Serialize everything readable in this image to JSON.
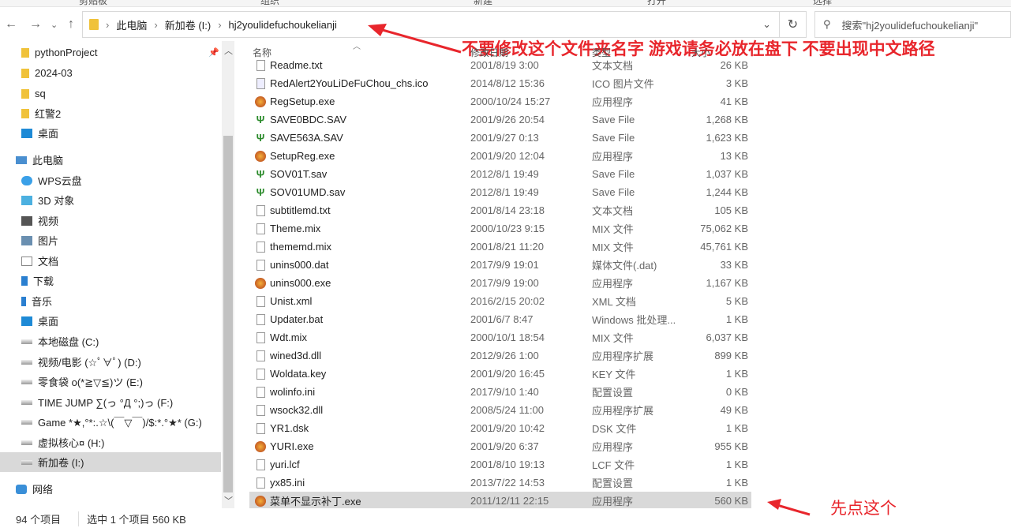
{
  "ribbon": [
    "剪贴板",
    "组织",
    "新建",
    "打开",
    "选择"
  ],
  "breadcrumb": [
    "此电脑",
    "新加卷 (I:)",
    "hj2youlidefuchoukelianji"
  ],
  "search_placeholder": "搜索\"hj2youlidefuchoukelianji\"",
  "annotations": {
    "top": "不要修改这个文件夹名字 游戏请务必放在盘下 不要出现中文路径",
    "bottom": "先点这个"
  },
  "columns": [
    "名称",
    "修改日期",
    "类型",
    "大小"
  ],
  "sidebar": [
    {
      "label": "pythonProject",
      "icon": "folder-icon",
      "pinned": true
    },
    {
      "label": "2024-03",
      "icon": "folder-icon"
    },
    {
      "label": "sq",
      "icon": "folder-icon"
    },
    {
      "label": "红警2",
      "icon": "folder-icon"
    },
    {
      "label": "桌面",
      "icon": "desktop-icon"
    },
    {
      "label": "此电脑",
      "icon": "computer-icon"
    },
    {
      "label": "WPS云盘",
      "icon": "cloud-icon"
    },
    {
      "label": "3D 对象",
      "icon": "cube-icon"
    },
    {
      "label": "视频",
      "icon": "video-icon"
    },
    {
      "label": "图片",
      "icon": "picture-icon"
    },
    {
      "label": "文档",
      "icon": "document-icon"
    },
    {
      "label": "下载",
      "icon": "download-icon"
    },
    {
      "label": "音乐",
      "icon": "music-icon"
    },
    {
      "label": "桌面",
      "icon": "desktop-icon"
    },
    {
      "label": "本地磁盘 (C:)",
      "icon": "drive-icon"
    },
    {
      "label": "视频/电影 (☆ﾟ∀ﾟ) (D:)",
      "icon": "drive-icon"
    },
    {
      "label": "零食袋 o(*≧▽≦)ツ (E:)",
      "icon": "drive-icon"
    },
    {
      "label": "TIME JUMP ∑(っ °Д °;)っ (F:)",
      "icon": "drive-icon"
    },
    {
      "label": "Game  *★,°*:.☆\\(￣▽￣)/$:*.°★* (G:)",
      "icon": "drive-icon"
    },
    {
      "label": "虚拟核心¤ (H:)",
      "icon": "drive-icon"
    },
    {
      "label": "新加卷 (I:)",
      "icon": "drive-icon",
      "selected": true
    },
    {
      "label": "网络",
      "icon": "network-icon"
    }
  ],
  "files": [
    {
      "name": "Readme.txt",
      "date": "2001/8/19 3:00",
      "type": "文本文档",
      "size": "26 KB"
    },
    {
      "name": "RedAlert2YouLiDeFuChou_chs.ico",
      "date": "2014/8/12 15:36",
      "type": "ICO 图片文件",
      "size": "3 KB"
    },
    {
      "name": "RegSetup.exe",
      "date": "2000/10/24 15:27",
      "type": "应用程序",
      "size": "41 KB"
    },
    {
      "name": "SAVE0BDC.SAV",
      "date": "2001/9/26 20:54",
      "type": "Save File",
      "size": "1,268 KB"
    },
    {
      "name": "SAVE563A.SAV",
      "date": "2001/9/27 0:13",
      "type": "Save File",
      "size": "1,623 KB"
    },
    {
      "name": "SetupReg.exe",
      "date": "2001/9/20 12:04",
      "type": "应用程序",
      "size": "13 KB"
    },
    {
      "name": "SOV01T.sav",
      "date": "2012/8/1 19:49",
      "type": "Save File",
      "size": "1,037 KB"
    },
    {
      "name": "SOV01UMD.sav",
      "date": "2012/8/1 19:49",
      "type": "Save File",
      "size": "1,244 KB"
    },
    {
      "name": "subtitlemd.txt",
      "date": "2001/8/14 23:18",
      "type": "文本文档",
      "size": "105 KB"
    },
    {
      "name": "Theme.mix",
      "date": "2000/10/23 9:15",
      "type": "MIX 文件",
      "size": "75,062 KB"
    },
    {
      "name": "thememd.mix",
      "date": "2001/8/21 11:20",
      "type": "MIX 文件",
      "size": "45,761 KB"
    },
    {
      "name": "unins000.dat",
      "date": "2017/9/9 19:01",
      "type": "媒体文件(.dat)",
      "size": "33 KB"
    },
    {
      "name": "unins000.exe",
      "date": "2017/9/9 19:00",
      "type": "应用程序",
      "size": "1,167 KB"
    },
    {
      "name": "Unist.xml",
      "date": "2016/2/15 20:02",
      "type": "XML 文档",
      "size": "5 KB"
    },
    {
      "name": "Updater.bat",
      "date": "2001/6/7 8:47",
      "type": "Windows 批处理...",
      "size": "1 KB"
    },
    {
      "name": "Wdt.mix",
      "date": "2000/10/1 18:54",
      "type": "MIX 文件",
      "size": "6,037 KB"
    },
    {
      "name": "wined3d.dll",
      "date": "2012/9/26 1:00",
      "type": "应用程序扩展",
      "size": "899 KB"
    },
    {
      "name": "Woldata.key",
      "date": "2001/9/20 16:45",
      "type": "KEY 文件",
      "size": "1 KB"
    },
    {
      "name": "wolinfo.ini",
      "date": "2017/9/10 1:40",
      "type": "配置设置",
      "size": "0 KB"
    },
    {
      "name": "wsock32.dll",
      "date": "2008/5/24 11:00",
      "type": "应用程序扩展",
      "size": "49 KB"
    },
    {
      "name": "YR1.dsk",
      "date": "2001/9/20 10:42",
      "type": "DSK 文件",
      "size": "1 KB"
    },
    {
      "name": "YURI.exe",
      "date": "2001/9/20 6:37",
      "type": "应用程序",
      "size": "955 KB"
    },
    {
      "name": "yuri.lcf",
      "date": "2001/8/10 19:13",
      "type": "LCF 文件",
      "size": "1 KB"
    },
    {
      "name": "yx85.ini",
      "date": "2013/7/22 14:53",
      "type": "配置设置",
      "size": "1 KB"
    },
    {
      "name": "菜单不显示补丁.exe",
      "date": "2011/12/11 22:15",
      "type": "应用程序",
      "size": "560 KB",
      "selected": true
    }
  ],
  "status": {
    "count": "94 个项目",
    "selection": "选中 1 个项目  560 KB"
  }
}
